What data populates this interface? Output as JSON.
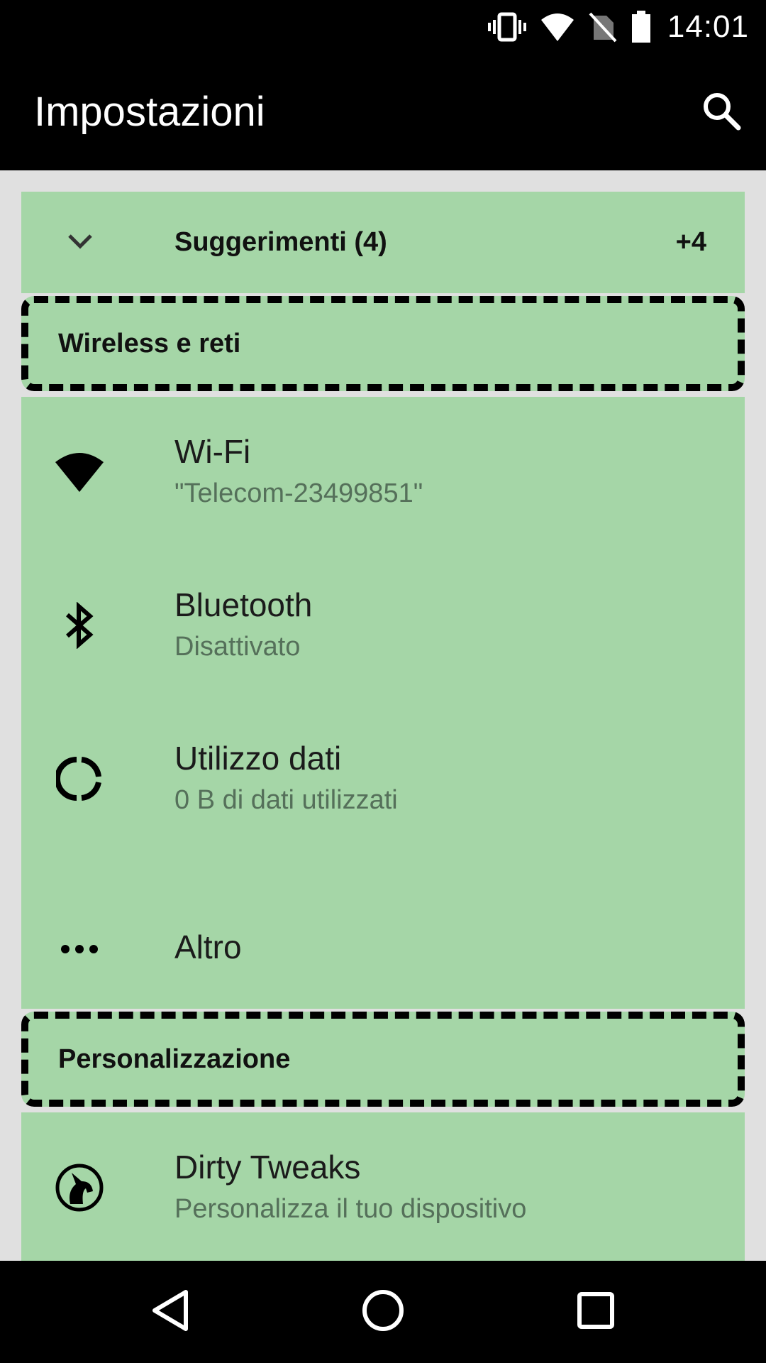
{
  "status_bar": {
    "time": "14:01",
    "icons": [
      "vibrate-icon",
      "wifi-icon",
      "no-sim-icon",
      "battery-icon"
    ]
  },
  "app_bar": {
    "title": "Impostazioni",
    "search_icon": "search-icon"
  },
  "suggestions": {
    "title": "Suggerimenti (4)",
    "count": "+4",
    "icon": "chevron-down-icon"
  },
  "categories": [
    {
      "title": "Wireless e reti",
      "items": [
        {
          "title": "Wi-Fi",
          "subtitle": "\"Telecom-23499851\"",
          "icon": "wifi-icon"
        },
        {
          "title": "Bluetooth",
          "subtitle": "Disattivato",
          "icon": "bluetooth-icon"
        },
        {
          "title": "Utilizzo dati",
          "subtitle": "0 B di dati utilizzati",
          "icon": "data-usage-icon"
        },
        {
          "title": "Altro",
          "subtitle": "",
          "icon": "more-horiz-icon"
        }
      ]
    },
    {
      "title": "Personalizzazione",
      "items": [
        {
          "title": "Dirty Tweaks",
          "subtitle": "Personalizza il tuo dispositivo",
          "icon": "unicorn-icon"
        }
      ]
    }
  ],
  "nav_bar": {
    "icons": [
      "back-icon",
      "home-icon",
      "recents-icon"
    ]
  },
  "colors": {
    "tile_background": "#a5d6a7",
    "page_background": "#e0e0e0",
    "bars": "#000000"
  }
}
